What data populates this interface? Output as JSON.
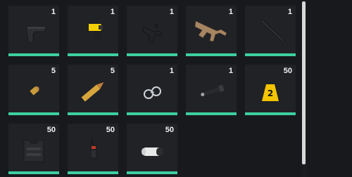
{
  "inventory": {
    "slots": [
      {
        "item": "pistol-icon",
        "count": "1"
      },
      {
        "item": "taser-icon",
        "count": "1"
      },
      {
        "item": "smg-icon",
        "count": "1"
      },
      {
        "item": "assault-rifle-icon",
        "count": "1"
      },
      {
        "item": "baton-icon",
        "count": "1"
      },
      {
        "item": "pistol-ammo-icon",
        "count": "5"
      },
      {
        "item": "rifle-ammo-icon",
        "count": "5"
      },
      {
        "item": "handcuffs-icon",
        "count": "1"
      },
      {
        "item": "flashlight-icon",
        "count": "1"
      },
      {
        "item": "evidence-marker-icon",
        "count": "50"
      },
      {
        "item": "body-armor-icon",
        "count": "50"
      },
      {
        "item": "radio-icon",
        "count": "50"
      },
      {
        "item": "bandage-roll-icon",
        "count": "50"
      }
    ],
    "marker_number": "2"
  },
  "colors": {
    "background": "#18191d",
    "slot": "#202226",
    "durability_bar": "#3ecf9f",
    "marker_yellow": "#f5c400"
  }
}
